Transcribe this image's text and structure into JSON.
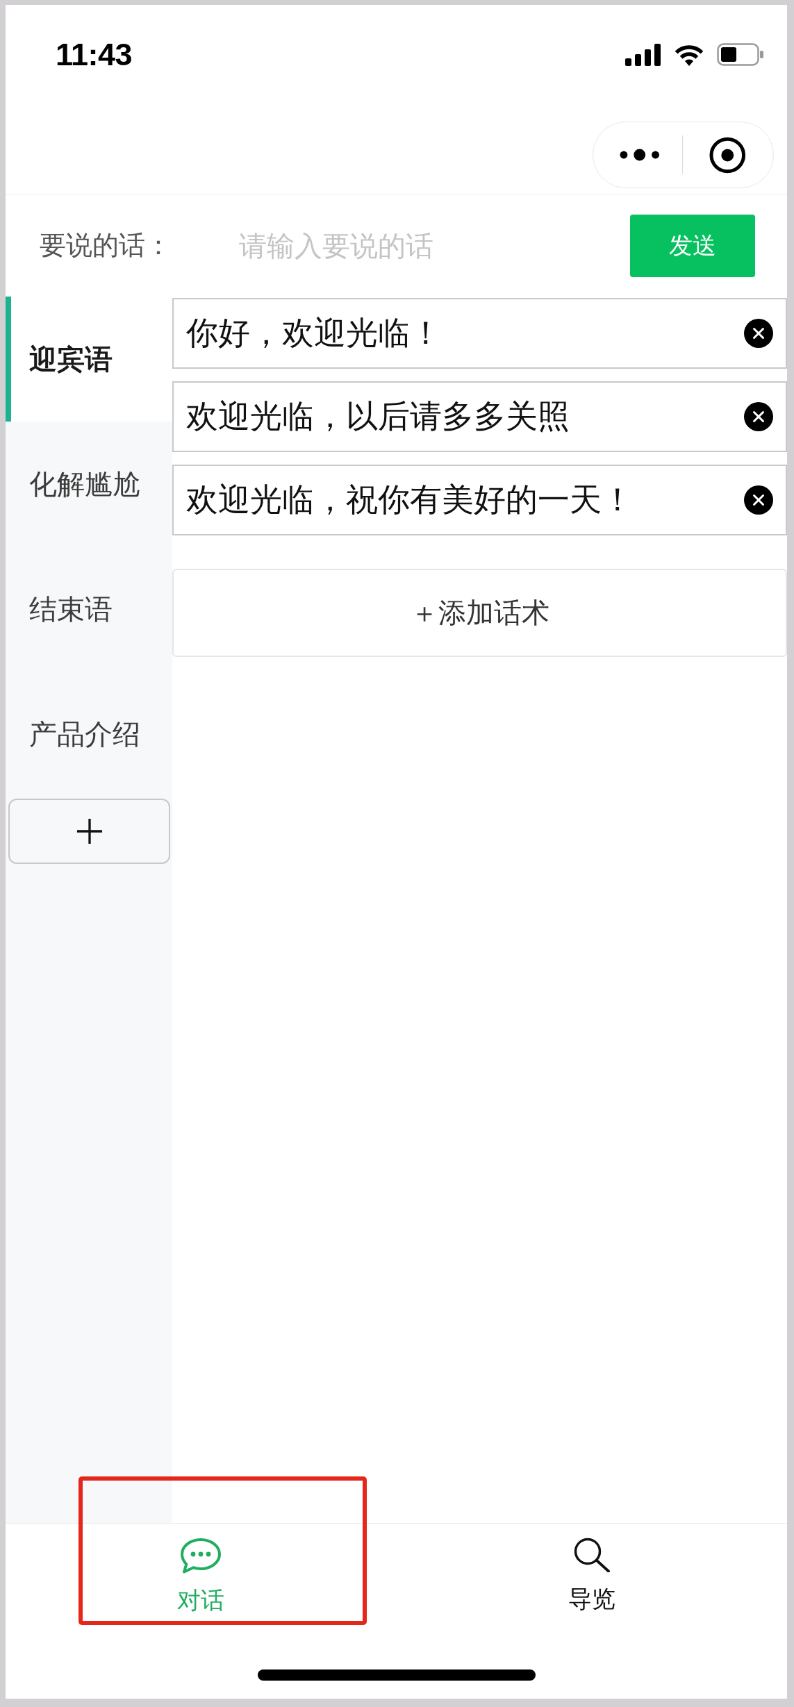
{
  "status_bar": {
    "time": "11:43"
  },
  "input_row": {
    "label": "要说的话：",
    "placeholder": "请输入要说的话",
    "send_button": "发送"
  },
  "sidebar": {
    "items": [
      {
        "label": "迎宾语",
        "selected": true
      },
      {
        "label": "化解尴尬",
        "selected": false
      },
      {
        "label": "结束语",
        "selected": false
      },
      {
        "label": "产品介绍",
        "selected": false
      }
    ]
  },
  "phrases": {
    "items": [
      {
        "text": "你好，欢迎光临！"
      },
      {
        "text": "欢迎光临，以后请多多关照"
      },
      {
        "text": "欢迎光临，祝你有美好的一天！"
      }
    ],
    "add_button": "＋添加话术"
  },
  "tab_bar": {
    "tabs": [
      {
        "label": "对话",
        "selected": true,
        "highlighted": true
      },
      {
        "label": "导览",
        "selected": false,
        "highlighted": false
      }
    ]
  }
}
